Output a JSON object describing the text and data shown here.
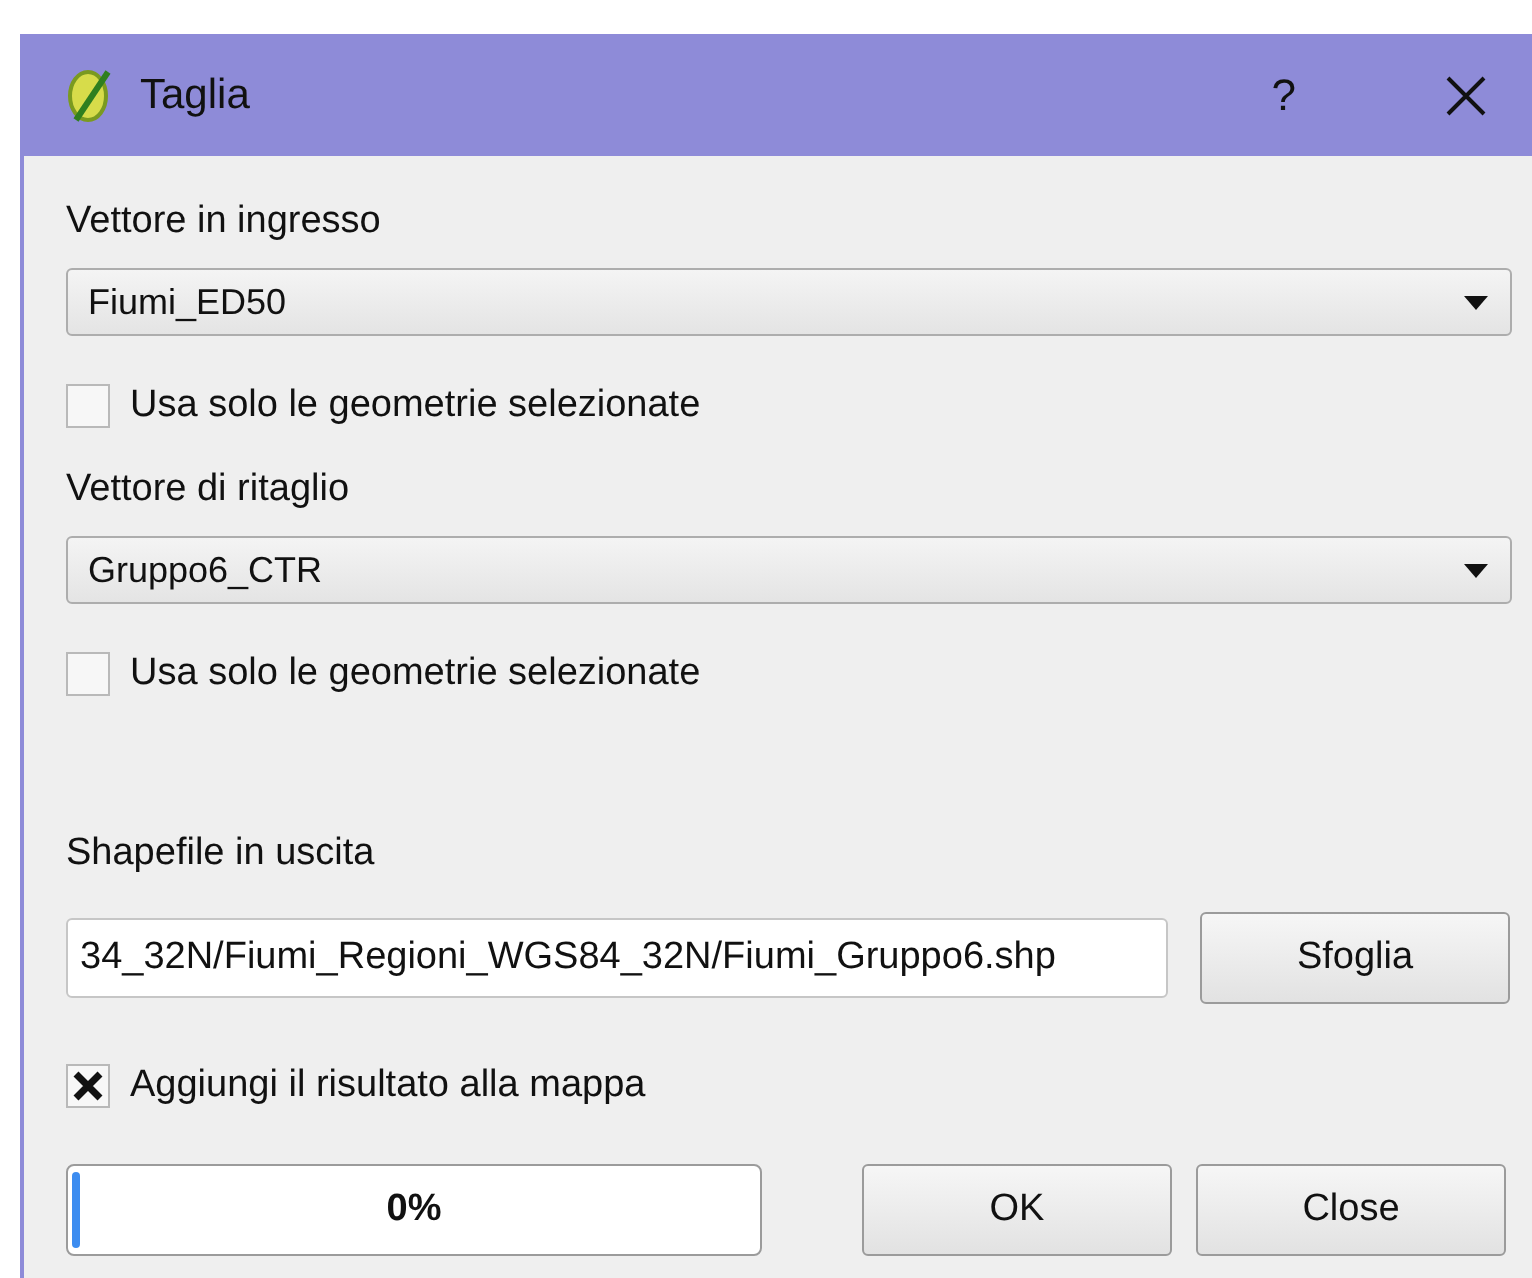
{
  "window": {
    "title": "Taglia",
    "help": "?"
  },
  "input_layer": {
    "label": "Vettore in ingresso",
    "value": "Fiumi_ED50",
    "selected_only": {
      "label": "Usa solo le geometrie selezionate",
      "checked": false
    }
  },
  "clip_layer": {
    "label": "Vettore di ritaglio",
    "value": "Gruppo6_CTR",
    "selected_only": {
      "label": "Usa solo le geometrie selezionate",
      "checked": false
    }
  },
  "output": {
    "label": "Shapefile in uscita",
    "value": "34_32N/Fiumi_Regioni_WGS84_32N/Fiumi_Gruppo6.shp",
    "browse": "Sfoglia"
  },
  "add_to_map": {
    "label": "Aggiungi il risultato alla mappa",
    "checked": true
  },
  "progress": {
    "level": 0,
    "reading": "0%"
  },
  "buttons": [
    "OK",
    "Close"
  ]
}
